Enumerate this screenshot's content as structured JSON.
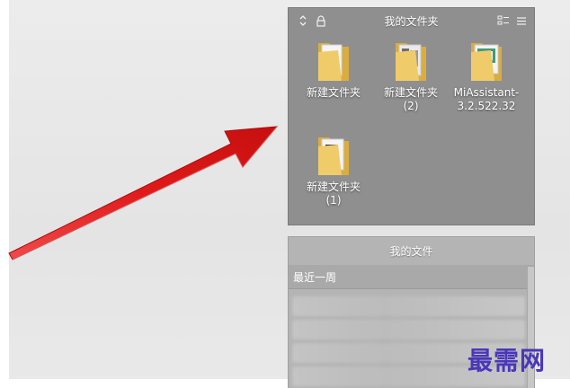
{
  "folder_fence": {
    "title": "我的文件夹",
    "icons": [
      {
        "label": "新建文件夹",
        "icon": "folder-icon"
      },
      {
        "label": "新建文件夹 (2)",
        "icon": "folder-icon"
      },
      {
        "label": "MiAssistant-3.2.522.32",
        "icon": "folder-icon"
      },
      {
        "label": "新建文件夹 (1)",
        "icon": "folder-icon"
      }
    ]
  },
  "files_fence": {
    "title": "我的文件",
    "section": "最近一周"
  },
  "watermark": "最需网",
  "colors": {
    "arrow": "#e41b1b",
    "fence_bg": "#8f8f8f",
    "watermark": "#4a37b8",
    "folder": "#e9c25a"
  }
}
